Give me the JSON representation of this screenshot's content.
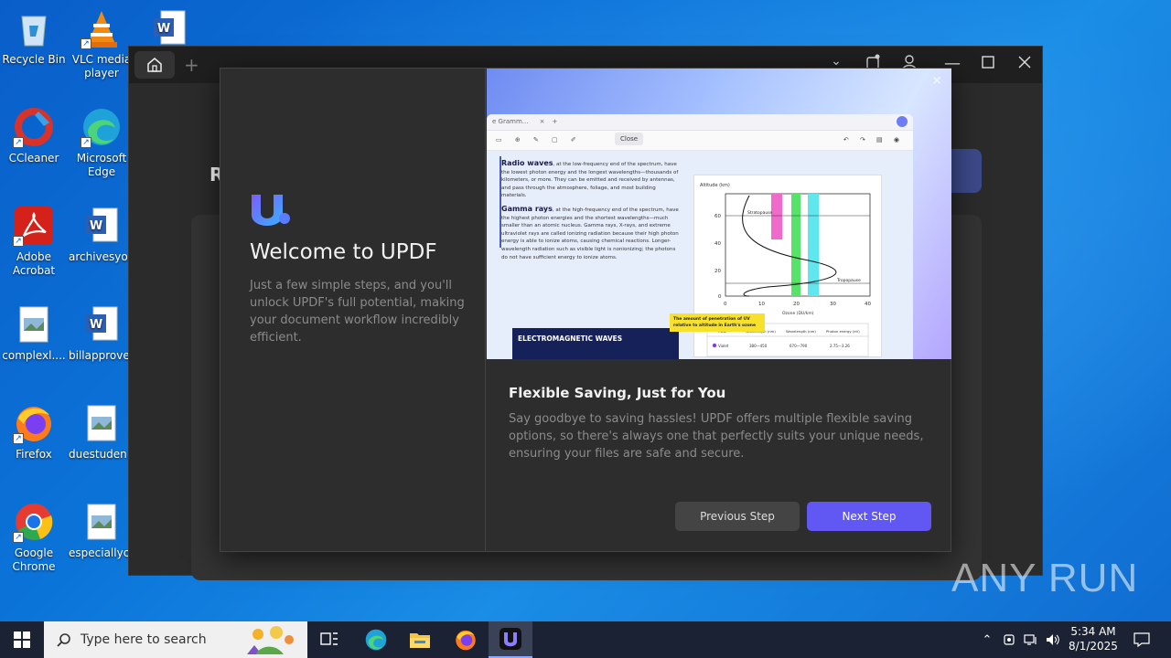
{
  "desktop": {
    "icons": [
      {
        "label": "Recycle Bin",
        "icon": "recycle-bin-icon"
      },
      {
        "label": "VLC media player",
        "icon": "vlc-icon"
      },
      {
        "label": "",
        "icon": "word-doc-icon"
      },
      {
        "label": "CCleaner",
        "icon": "ccleaner-icon"
      },
      {
        "label": "Microsoft Edge",
        "icon": "edge-icon"
      },
      {
        "label": "Adobe Acrobat",
        "icon": "acrobat-icon"
      },
      {
        "label": "archivesyo...",
        "icon": "word-doc-icon"
      },
      {
        "label": "complexl....",
        "icon": "image-file-icon"
      },
      {
        "label": "billapprove...",
        "icon": "word-doc-icon"
      },
      {
        "label": "Firefox",
        "icon": "firefox-icon"
      },
      {
        "label": "duestuden...",
        "icon": "image-file-icon"
      },
      {
        "label": "Google Chrome",
        "icon": "chrome-icon"
      },
      {
        "label": "especiallyc...",
        "icon": "image-file-icon"
      }
    ]
  },
  "app": {
    "background_letter": "R"
  },
  "dialog": {
    "welcome_title": "Welcome to UPDF",
    "welcome_desc": "Just a few simple steps, and you'll unlock UPDF's full potential, making your document workflow incredibly efficient.",
    "slide_title": "Flexible Saving, Just for You",
    "slide_desc": "Say goodbye to saving hassles! UPDF offers multiple flexible saving options, so there's always one that perfectly suits your unique needs, ensuring your files are safe and secure.",
    "prev_label": "Previous Step",
    "next_label": "Next Step",
    "accent_color": "#6157f2",
    "preview": {
      "tab_label": "e Gramm...",
      "toolbar_close": "Close",
      "para1_title": "Radio waves",
      "para1_text": ", at the low-frequency end of the spectrum, have the lowest photon energy and the longest wavelengths—thousands of kilometers, or more. They can be emitted and received by antennas, and pass through the atmosphere, foliage, and most building materials.",
      "para2_title": "Gamma rays",
      "para2_text": ", at the high-frequency end of the spectrum, have the highest photon energies and the shortest wavelengths—much smaller than an atomic nucleus. Gamma rays, X-rays, and extreme ultraviolet rays are called ionizing radiation because their high photon energy is able to ionize atoms, causing chemical reactions. Longer-wavelength radiation such as visible light is nonionizing; the photons do not have sufficient energy to ionize atoms.",
      "em_box": "ELECTROMAGNETIC WAVES",
      "callout": "The amount of penetration of UV relative to altitude in Earth's ozone",
      "chart_ylabel": "Altitude (km)",
      "chart_xlabel": "Ozone (DU/km)",
      "chart_stratopause": "Stratopause",
      "chart_tropopause": "Tropopause",
      "y_ticks": [
        "60",
        "40",
        "20",
        "0"
      ],
      "x_ticks": [
        "0",
        "10",
        "20",
        "30",
        "40"
      ],
      "table_headers": [
        "Color",
        "Wavelength (nm)",
        "Wavelength (nm)",
        "Photon energy (eV)"
      ],
      "table_row": [
        "Violet",
        "380—450",
        "670—790",
        "2.75—3.26"
      ]
    }
  },
  "taskbar": {
    "search_placeholder": "Type here to search",
    "time": "5:34 AM",
    "date": "8/1/2025"
  },
  "watermark": "ANY RUN"
}
